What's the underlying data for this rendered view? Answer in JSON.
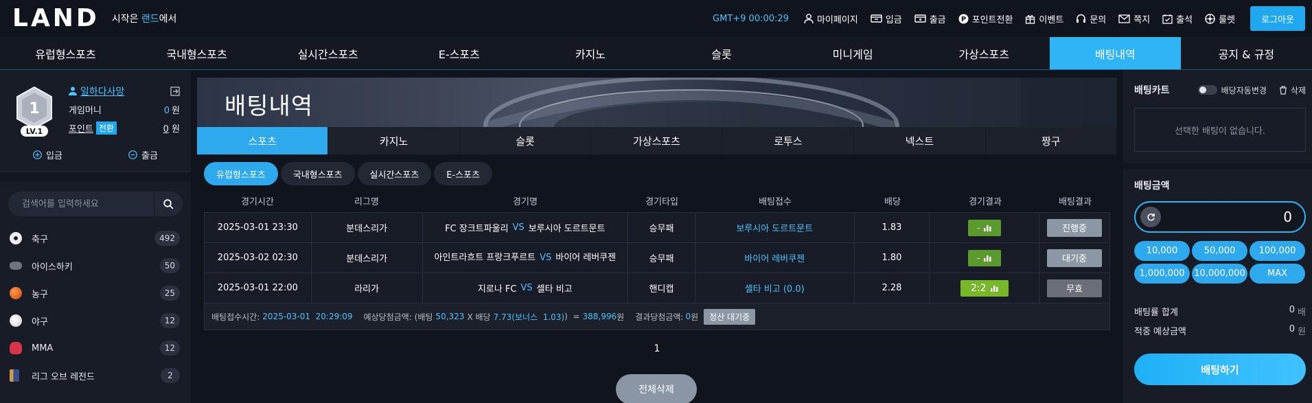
{
  "header": {
    "logo": "LAND",
    "tagline_pre": "시작은 ",
    "tagline_accent": "랜드",
    "tagline_post": "에서",
    "clock": "GMT+9 00:00:29",
    "menu": [
      {
        "label": "마이페이지",
        "icon": "user-icon"
      },
      {
        "label": "입금",
        "icon": "deposit-icon"
      },
      {
        "label": "출금",
        "icon": "withdraw-icon"
      },
      {
        "label": "포인트전환",
        "icon": "point-icon"
      },
      {
        "label": "이벤트",
        "icon": "gift-icon"
      },
      {
        "label": "문의",
        "icon": "headset-icon"
      },
      {
        "label": "쪽지",
        "icon": "mail-icon"
      },
      {
        "label": "출석",
        "icon": "calendar-icon"
      },
      {
        "label": "룰렛",
        "icon": "roulette-icon"
      }
    ],
    "logout": "로그아웃"
  },
  "nav": [
    "유럽형스포츠",
    "국내형스포츠",
    "실시간스포츠",
    "E-스포츠",
    "카지노",
    "슬롯",
    "미니게임",
    "가상스포츠",
    "배팅내역",
    "공지 & 규정"
  ],
  "nav_active": "배팅내역",
  "profile": {
    "level_number": "1",
    "level": "LV.1",
    "username": "일하다사망",
    "money_label": "게임머니",
    "money_value": "0",
    "money_unit": "원",
    "point_label": "포인트",
    "convert_label": "전환",
    "point_value": "0",
    "point_unit": "원",
    "deposit": "입금",
    "withdraw": "출금"
  },
  "search": {
    "placeholder": "검색어를 입력하세요"
  },
  "sports": [
    {
      "name": "축구",
      "count": "492",
      "icon": "soccer-icon",
      "color": "#e9e9e9"
    },
    {
      "name": "아이스하키",
      "count": "50",
      "icon": "hockey-puck-icon",
      "color": "#8a8f98"
    },
    {
      "name": "농구",
      "count": "25",
      "icon": "basketball-icon",
      "color": "#e2651c"
    },
    {
      "name": "야구",
      "count": "12",
      "icon": "baseball-icon",
      "color": "#f2f2f2"
    },
    {
      "name": "MMA",
      "count": "12",
      "icon": "boxing-glove-icon",
      "color": "#d8344a"
    },
    {
      "name": "리그 오브 레전드",
      "count": "2",
      "icon": "lol-icon",
      "color": "#c8a04a"
    }
  ],
  "main": {
    "banner_title": "배팅내역",
    "categories": [
      "스포츠",
      "카지노",
      "슬롯",
      "가상스포츠",
      "로투스",
      "넥스트",
      "짱구"
    ],
    "category_active": "스포츠",
    "subtabs": [
      "유럽형스포츠",
      "국내형스포츠",
      "실시간스포츠",
      "E-스포츠"
    ],
    "subtab_active": "유럽형스포츠",
    "columns": [
      "경기시간",
      "리그명",
      "경기명",
      "경기타입",
      "배팅접수",
      "배당",
      "경기결과",
      "배팅결과"
    ],
    "rows": [
      {
        "time": "2025-03-01 23:30",
        "league": "분데스리가",
        "home": "FC 장크트파울리",
        "vs": "VS",
        "away": "보루시아 도르트문트",
        "type": "승무패",
        "pick": "보루시아 도르트문트",
        "odds": "1.83",
        "score": "-",
        "status": "진행중"
      },
      {
        "time": "2025-03-02 02:30",
        "league": "분데스리가",
        "home": "아인트라흐트 프랑크푸르트",
        "vs": "VS",
        "away": "바이어 레버쿠젠",
        "type": "승무패",
        "pick": "바이어 레버쿠젠",
        "odds": "1.80",
        "score": "-",
        "status": "대기중"
      },
      {
        "time": "2025-03-01 22:00",
        "league": "라리가",
        "home": "지로나 FC",
        "vs": "VS",
        "away": "셀타 비고",
        "type": "핸디캡",
        "pick": "셀타 비고 (0.0)",
        "odds": "2.28",
        "score": "2:2",
        "status": "무효"
      }
    ],
    "summary": {
      "time_label": "배팅접수시간:",
      "time_value": "2025-03-01  20:29:09",
      "expected_label": "예상당첨금액: (배팅",
      "stake": "50,323",
      "x_label": "X 배당",
      "odds": "7.73(보너스  1.03)",
      "eq": ")  =",
      "payout": "388,996",
      "payout_unit": "원",
      "result_label": "결과당첨금액:",
      "result_value": "0",
      "result_unit": "원",
      "settle": "정산 대기중"
    },
    "page": "1",
    "delete_all": "전체삭제"
  },
  "cart": {
    "title": "배팅카트",
    "auto_label": "배당자동변경",
    "delete": "삭제",
    "empty": "선택한 배팅이 없습니다.",
    "amount_title": "배팅금액",
    "amount_value": "0",
    "chips": [
      "10,000",
      "50,000",
      "100,000",
      "1,000,000",
      "10,000,000",
      "MAX"
    ],
    "rate_label": "배팅률 합계",
    "rate_value": "0",
    "rate_unit": "배",
    "expected_label": "적중 예상금액",
    "expected_value": "0",
    "expected_unit": "원",
    "bet_button": "배팅하기"
  },
  "colors": {
    "accent": "#2fb4f6",
    "link": "#4fc3ff",
    "bg": "#10141c",
    "panel": "#181c26"
  }
}
